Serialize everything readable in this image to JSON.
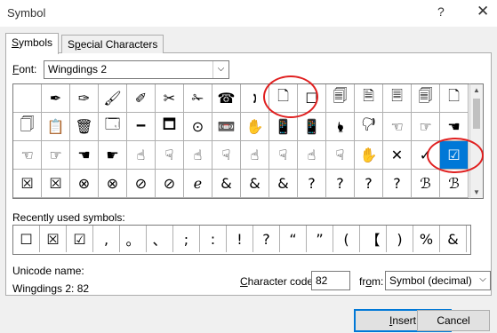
{
  "window": {
    "title": "Symbol",
    "help_glyph": "?",
    "close_glyph": "✕"
  },
  "tabs": [
    {
      "label_first": "S",
      "label_rest": "ymbols"
    },
    {
      "label_first": "S",
      "label_rest": "pecial Characters",
      "prefix": ""
    }
  ],
  "font": {
    "label_first": "F",
    "label_rest": "ont:",
    "value": "Wingdings 2",
    "arrow": "⌵"
  },
  "grid": {
    "rows": [
      [
        "",
        "✒",
        "✑",
        "🖌",
        "✐",
        "✂",
        "✁",
        "☎",
        "🕽",
        "🗋",
        "☐",
        "🗐",
        "🗎",
        "🗏",
        "🗐",
        "🗋",
        "☐"
      ],
      [
        "🗍",
        "📋",
        "🗑",
        "🗔",
        "🗕",
        "🗖",
        "⊙",
        "📼",
        "✋",
        "📱",
        "📱",
        "🖢",
        "🖓",
        "☜",
        "☞",
        "☚",
        "☛"
      ],
      [
        "☜",
        "☞",
        "☚",
        "☛",
        "☝",
        "☟",
        "☝",
        "☟",
        "☝",
        "☟",
        "☝",
        "☟",
        "✋",
        "✕",
        "✓",
        "☒",
        "☑"
      ],
      [
        "☒",
        "☒",
        "⊗",
        "⊗",
        "⊘",
        "⊘",
        "ℯ",
        "&",
        "&",
        "&",
        "?",
        "?",
        "?",
        "?",
        "ℬ",
        "ℬ",
        "ℬ"
      ]
    ],
    "selected": [
      2,
      16
    ]
  },
  "recent": {
    "label": "Recently used symbols:",
    "items": [
      "☐",
      "☒",
      "☑",
      ",",
      "。",
      "、",
      ";",
      ":",
      "!",
      "?",
      "“",
      "”",
      "(",
      "【",
      ")",
      "%",
      "&"
    ]
  },
  "unicode": {
    "label": "Unicode name:",
    "value": "Wingdings 2: 82"
  },
  "char_code": {
    "label_first": "C",
    "label_rest": "haracter code:",
    "value": "82"
  },
  "from": {
    "label_pre": "fr",
    "label_u": "o",
    "label_post": "m:",
    "value": "Symbol (decimal)",
    "arrow": "⌵"
  },
  "buttons": {
    "insert_first": "I",
    "insert_rest": "nsert",
    "cancel": "Cancel"
  }
}
